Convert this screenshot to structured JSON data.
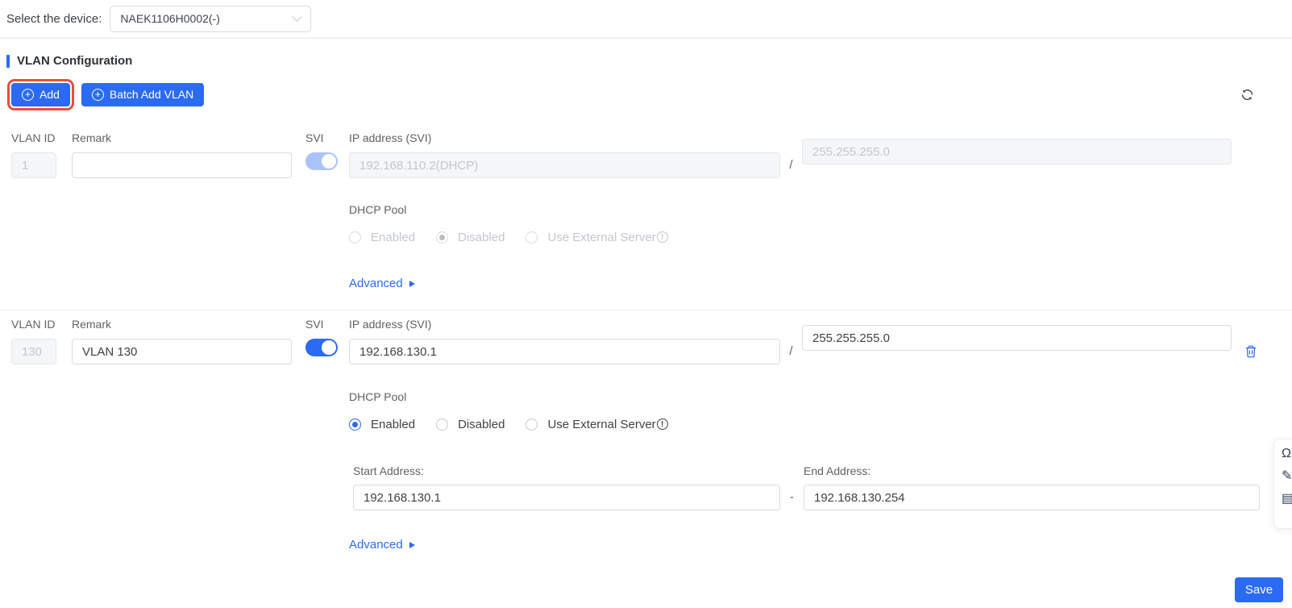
{
  "device_bar": {
    "label": "Select the device:",
    "selected": "NAEK1106H0002(-)"
  },
  "vlan_section": {
    "title": "VLAN Configuration"
  },
  "toolbar": {
    "add": "Add",
    "batch_add": "Batch Add VLAN"
  },
  "labels": {
    "vlan_id": "VLAN ID",
    "remark": "Remark",
    "svi": "SVI",
    "ip_svi": "IP address (SVI)",
    "dhcp_pool": "DHCP Pool",
    "advanced": "Advanced",
    "start_address": "Start Address:",
    "end_address": "End Address:",
    "slash": "/",
    "dash": "-",
    "dhcp_enabled": "Enabled",
    "dhcp_disabled": "Disabled",
    "dhcp_external": "Use External Server"
  },
  "rows": [
    {
      "vlan_id": "1",
      "remark": "",
      "svi_on": true,
      "ip": "192.168.110.2(DHCP)",
      "mask": "255.255.255.0",
      "dhcp_selected": "Disabled"
    },
    {
      "vlan_id": "130",
      "remark": "VLAN 130",
      "svi_on": true,
      "ip": "192.168.130.1",
      "mask": "255.255.255.0",
      "dhcp_selected": "Enabled",
      "start": "192.168.130.1",
      "end": "192.168.130.254"
    }
  ],
  "footer": {
    "save": "Save"
  },
  "colors": {
    "primary": "#2b6bf3",
    "highlight_red": "#e6503e"
  }
}
